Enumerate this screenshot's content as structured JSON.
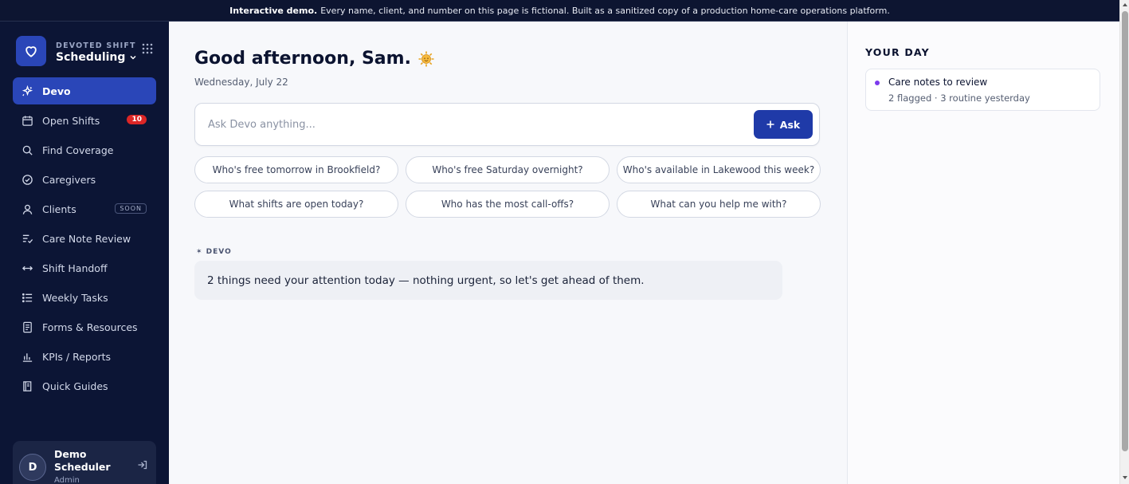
{
  "banner": {
    "bold": "Interactive demo.",
    "text": "Every name, client, and number on this page is fictional. Built as a sanitized copy of a production home-care operations platform."
  },
  "brand": {
    "kicker": "DEVOTED SHIFT",
    "product": "Scheduling",
    "logo_icon": "heart-icon"
  },
  "nav": [
    {
      "label": "Devo",
      "icon": "sparkle-icon",
      "active": true
    },
    {
      "label": "Open Shifts",
      "icon": "calendar-icon",
      "badge": "10"
    },
    {
      "label": "Find Coverage",
      "icon": "search-icon"
    },
    {
      "label": "Caregivers",
      "icon": "check-circle-icon"
    },
    {
      "label": "Clients",
      "icon": "user-icon",
      "tag": "SOON"
    },
    {
      "label": "Care Note Review",
      "icon": "list-check-icon"
    },
    {
      "label": "Shift Handoff",
      "icon": "arrows-horizontal-icon"
    },
    {
      "label": "Weekly Tasks",
      "icon": "list-icon"
    },
    {
      "label": "Forms & Resources",
      "icon": "document-icon"
    },
    {
      "label": "KPIs / Reports",
      "icon": "bar-chart-icon"
    },
    {
      "label": "Quick Guides",
      "icon": "book-icon"
    }
  ],
  "user": {
    "initial": "D",
    "name": "Demo Scheduler",
    "role": "Admin"
  },
  "main": {
    "greeting": "Good afternoon, Sam.",
    "greeting_icon": "sun-emoji-icon",
    "date": "Wednesday, July 22",
    "ask_placeholder": "Ask Devo anything...",
    "ask_button": "Ask",
    "chips": [
      "Who's free tomorrow in Brookfield?",
      "Who's free Saturday overnight?",
      "Who's available in Lakewood this week?",
      "What shifts are open today?",
      "Who has the most call-offs?",
      "What can you help me with?"
    ],
    "devo_label": "✶ DEVO",
    "devo_message": "2 things need your attention today — nothing urgent, so let's get ahead of them."
  },
  "your_day": {
    "title": "YOUR DAY",
    "items": [
      {
        "title": "Care notes to review",
        "subtitle": "2 flagged · 3 routine yesterday",
        "dot_color": "#7c3aed"
      }
    ]
  },
  "colors": {
    "sidebar_bg": "#0c1535",
    "accent": "#2a46b8",
    "badge_red": "#dc2626"
  }
}
